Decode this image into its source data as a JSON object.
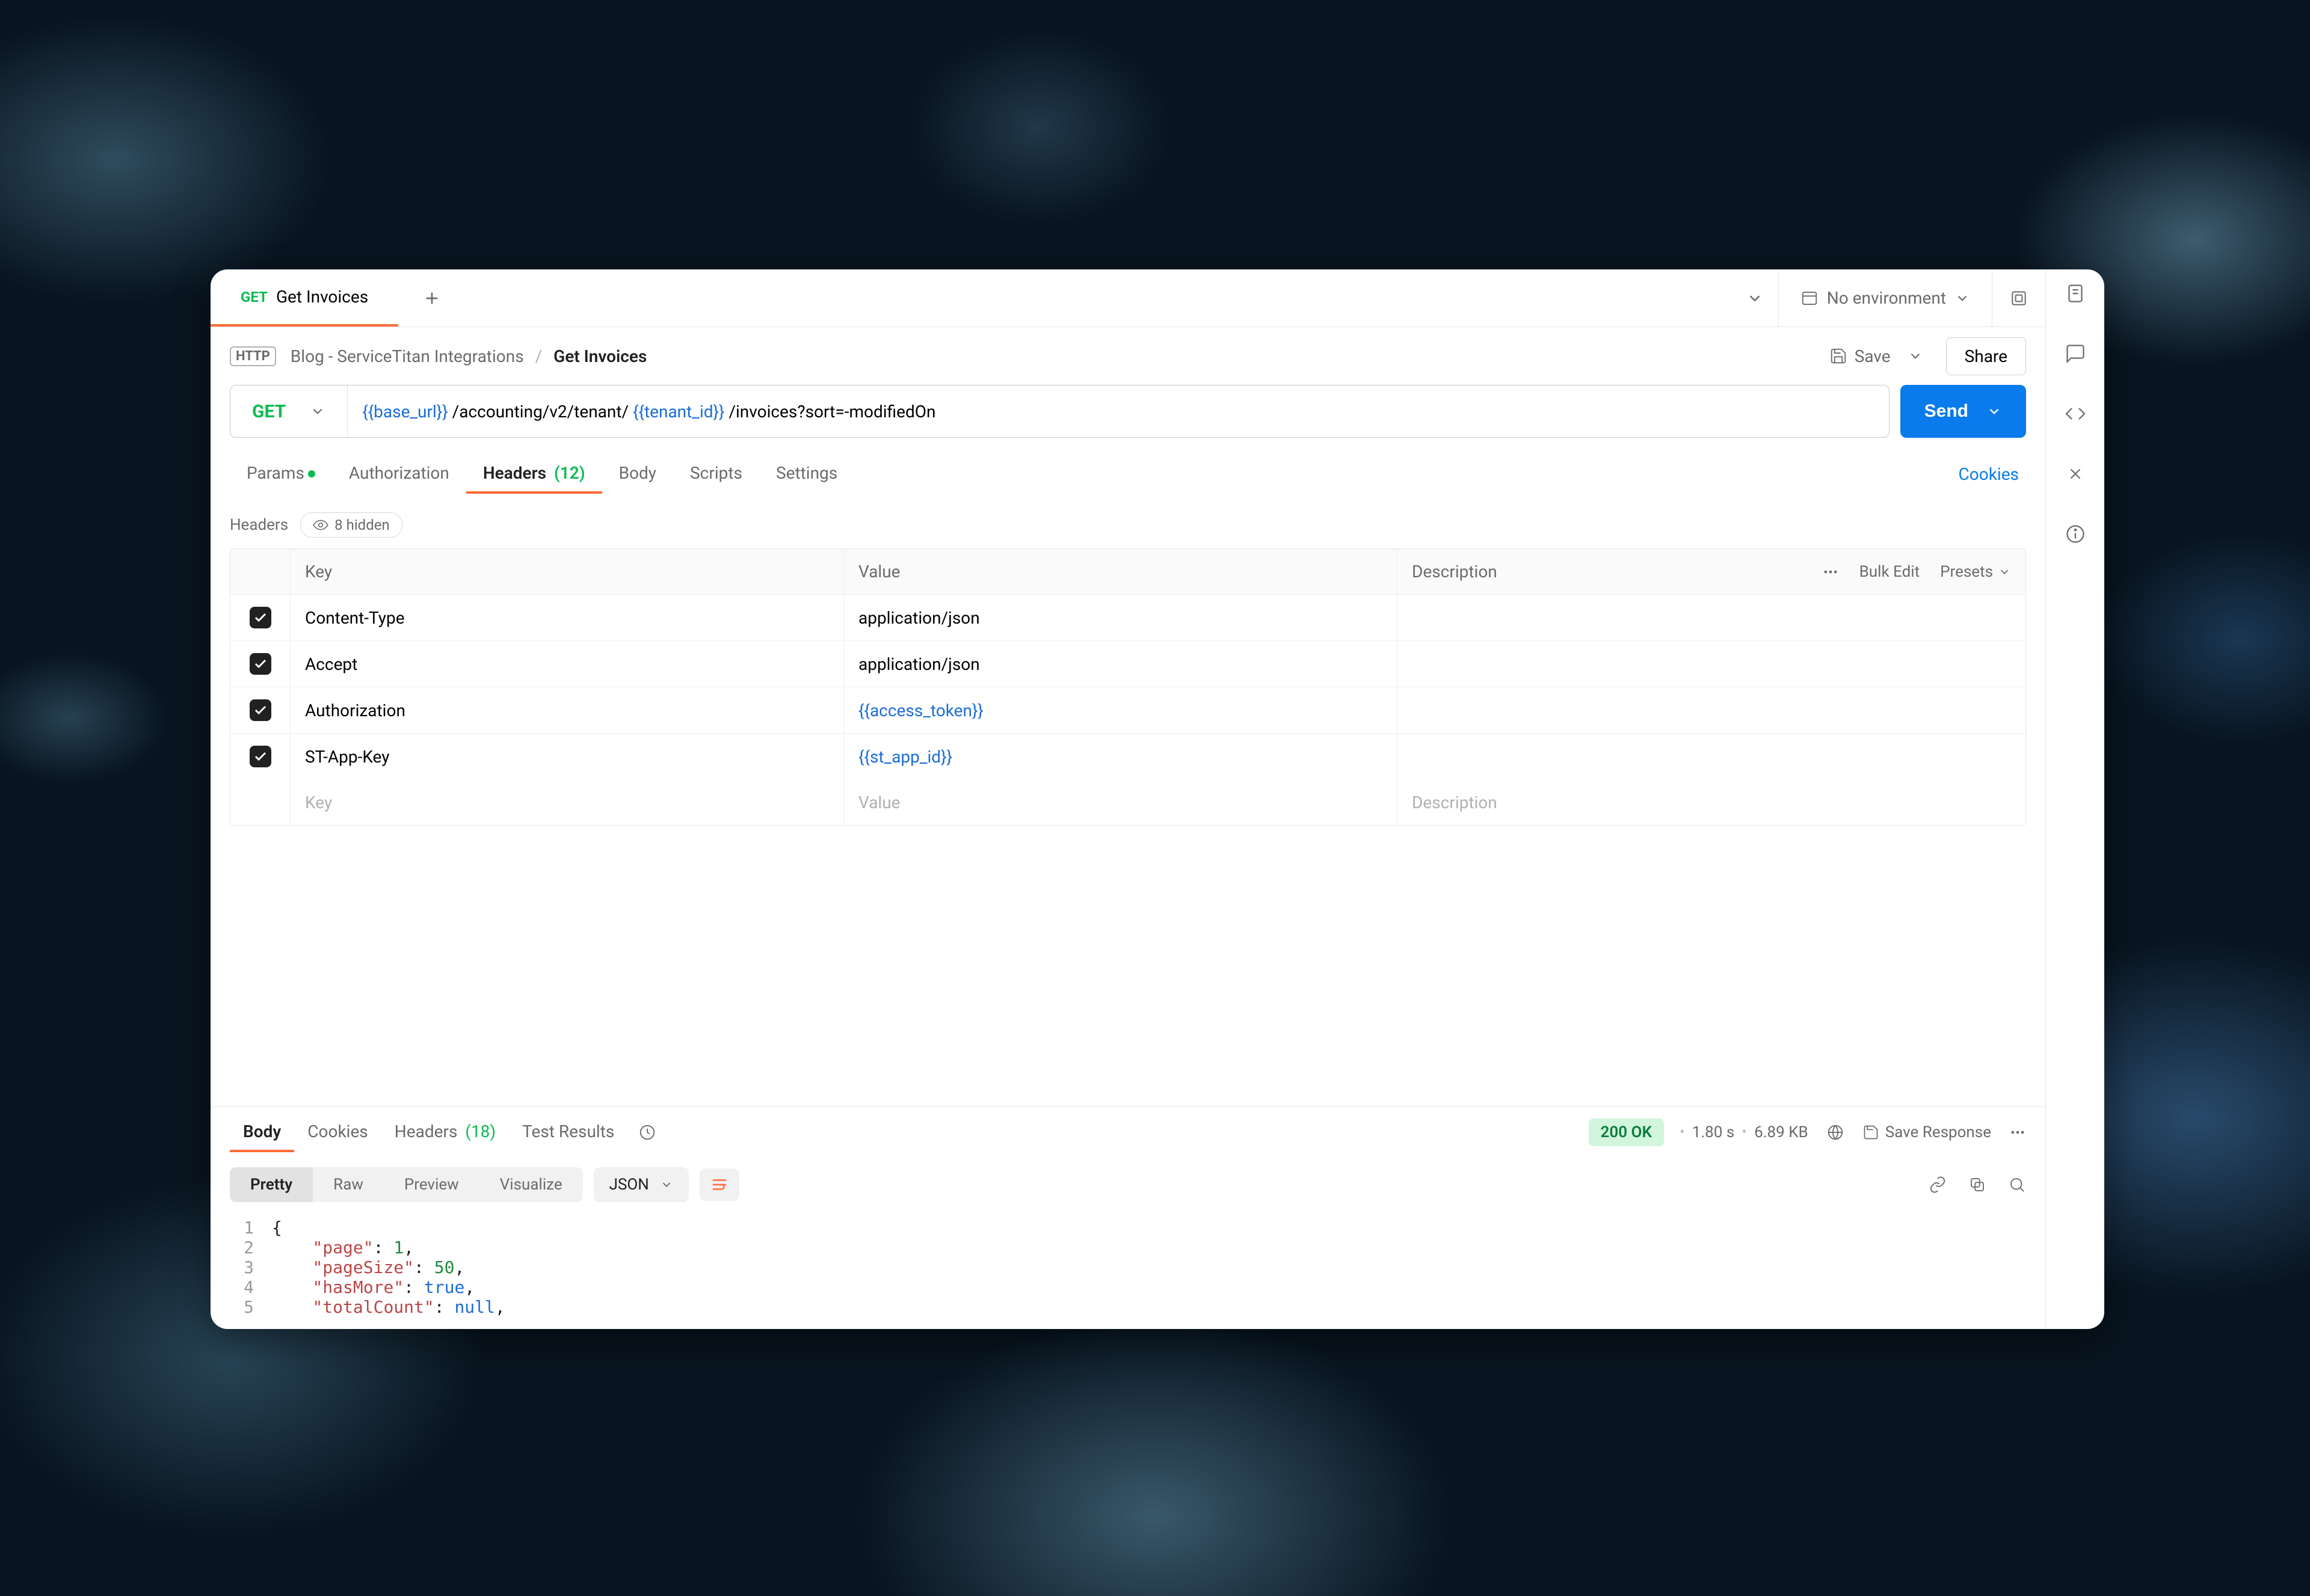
{
  "tabs": {
    "active_method": "GET",
    "active_title": "Get Invoices"
  },
  "environment": {
    "label": "No environment"
  },
  "breadcrumb": {
    "workspace": "Blog - ServiceTitan Integrations",
    "current": "Get Invoices",
    "save_label": "Save",
    "share_label": "Share"
  },
  "request": {
    "method": "GET",
    "url_parts": {
      "var1": "{{base_url}}",
      "seg1": " /accounting/v2/tenant/ ",
      "var2": "{{tenant_id}}",
      "seg2": " /invoices?sort=-modifiedOn"
    },
    "send_label": "Send"
  },
  "req_tabs": {
    "params": "Params",
    "authorization": "Authorization",
    "headers": "Headers",
    "headers_count": "(12)",
    "body": "Body",
    "scripts": "Scripts",
    "settings": "Settings",
    "cookies_link": "Cookies"
  },
  "headers_section": {
    "title": "Headers",
    "hidden_label": "8 hidden",
    "columns": {
      "key": "Key",
      "value": "Value",
      "description": "Description"
    },
    "tools": {
      "bulk_edit": "Bulk Edit",
      "presets": "Presets"
    },
    "rows": [
      {
        "key": "Content-Type",
        "value": "application/json",
        "is_var": false
      },
      {
        "key": "Accept",
        "value": "application/json",
        "is_var": false
      },
      {
        "key": "Authorization",
        "value": "{{access_token}}",
        "is_var": true
      },
      {
        "key": "ST-App-Key",
        "value": "{{st_app_id}}",
        "is_var": true
      }
    ],
    "placeholder": {
      "key": "Key",
      "value": "Value",
      "description": "Description"
    }
  },
  "response": {
    "tabs": {
      "body": "Body",
      "cookies": "Cookies",
      "headers": "Headers",
      "headers_count": "(18)",
      "test_results": "Test Results"
    },
    "status": "200 OK",
    "time": "1.80 s",
    "size": "6.89 KB",
    "save_response": "Save Response",
    "view_modes": {
      "pretty": "Pretty",
      "raw": "Raw",
      "preview": "Preview",
      "visualize": "Visualize"
    },
    "format": "JSON",
    "code_lines": [
      {
        "n": 1,
        "tokens": [
          {
            "t": "brace",
            "v": "{"
          }
        ]
      },
      {
        "n": 2,
        "tokens": [
          {
            "t": "indent",
            "v": "    "
          },
          {
            "t": "key",
            "v": "\"page\""
          },
          {
            "t": "punc",
            "v": ": "
          },
          {
            "t": "num",
            "v": "1"
          },
          {
            "t": "punc",
            "v": ","
          }
        ]
      },
      {
        "n": 3,
        "tokens": [
          {
            "t": "indent",
            "v": "    "
          },
          {
            "t": "key",
            "v": "\"pageSize\""
          },
          {
            "t": "punc",
            "v": ": "
          },
          {
            "t": "num",
            "v": "50"
          },
          {
            "t": "punc",
            "v": ","
          }
        ]
      },
      {
        "n": 4,
        "tokens": [
          {
            "t": "indent",
            "v": "    "
          },
          {
            "t": "key",
            "v": "\"hasMore\""
          },
          {
            "t": "punc",
            "v": ": "
          },
          {
            "t": "bool",
            "v": "true"
          },
          {
            "t": "punc",
            "v": ","
          }
        ]
      },
      {
        "n": 5,
        "tokens": [
          {
            "t": "indent",
            "v": "    "
          },
          {
            "t": "key",
            "v": "\"totalCount\""
          },
          {
            "t": "punc",
            "v": ": "
          },
          {
            "t": "null",
            "v": "null"
          },
          {
            "t": "punc",
            "v": ","
          }
        ]
      }
    ]
  }
}
